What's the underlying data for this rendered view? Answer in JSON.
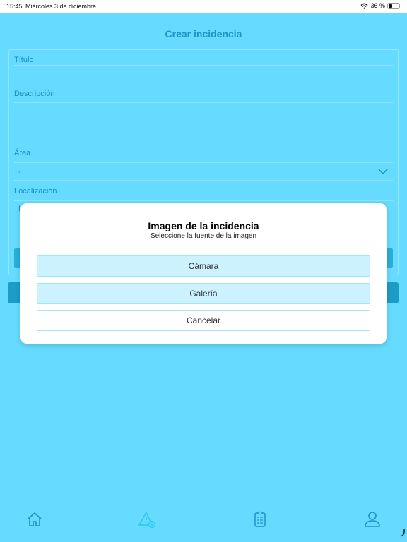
{
  "status_bar": {
    "time": "15:45",
    "date": "Miércoles 3 de diciembre",
    "battery": "36 %",
    "battery_level": 0.36
  },
  "screen": {
    "title": "Crear incidencia"
  },
  "form": {
    "title_label": "Título",
    "description_label": "Descripción",
    "area_label": "Área",
    "area_value": "-",
    "location_label": "Localización",
    "location_partial": "L"
  },
  "modal": {
    "title": "Imagen de la incidencia",
    "subtitle": "Seleccione la fuente de la imagen",
    "camera_label": "Cámara",
    "gallery_label": "Galería",
    "cancel_label": "Cancelar"
  },
  "tab_bar": {
    "tabs": [
      {
        "icon": "home-icon"
      },
      {
        "icon": "warning-add-icon",
        "active": true
      },
      {
        "icon": "clipboard-icon"
      },
      {
        "icon": "user-icon"
      }
    ]
  },
  "colors": {
    "background": "#66dbff",
    "accent": "#1d93c9",
    "modal_button": "#cdf2ff"
  }
}
